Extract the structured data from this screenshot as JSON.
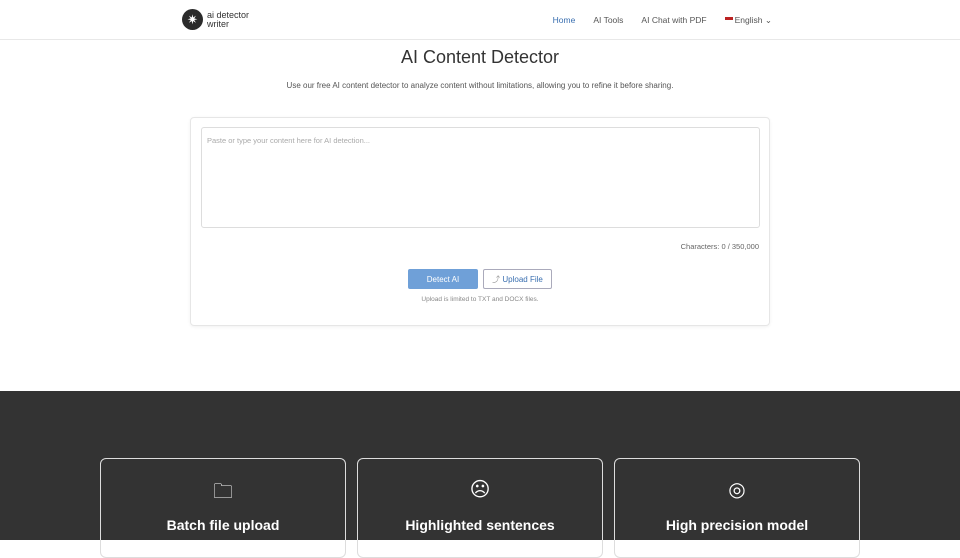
{
  "header": {
    "logo_line1": "ai detector",
    "logo_line2": "writer",
    "menu": [
      {
        "label": "Home"
      },
      {
        "label": "AI Tools"
      },
      {
        "label": "AI Chat with PDF"
      },
      {
        "label": "English"
      }
    ]
  },
  "main": {
    "title": "AI Content Detector",
    "subtitle": "Use our free AI content detector to analyze content without limitations, allowing you to refine it before sharing.",
    "placeholder": "Paste or type your content here for AI detection...",
    "value": "",
    "characters": "Characters: 0 / 350,000",
    "detect_label": "Detect AI",
    "upload_label": "Upload File",
    "upload_note": "Upload is limited to TXT and DOCX files."
  },
  "features": [
    {
      "label": "Batch file upload",
      "icon": "folder-icon"
    },
    {
      "label": "Highlighted sentences",
      "icon": "highlight-icon"
    },
    {
      "label": "High precision model",
      "icon": "target-icon"
    }
  ],
  "colors": {
    "accent": "#3a6fb0",
    "button": "#6fa0d8",
    "dark": "#333333"
  }
}
